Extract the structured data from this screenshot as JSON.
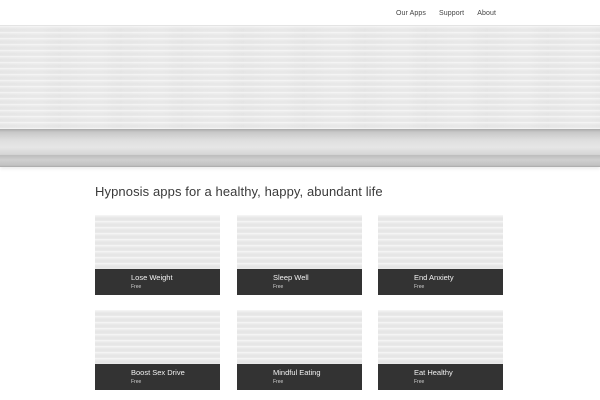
{
  "nav": {
    "items": [
      {
        "label": "Our Apps"
      },
      {
        "label": "Support"
      },
      {
        "label": "About"
      }
    ]
  },
  "headline": "Hypnosis apps for a healthy, happy, abundant life",
  "apps": [
    {
      "title": "Lose Weight",
      "price": "Free"
    },
    {
      "title": "Sleep Well",
      "price": "Free"
    },
    {
      "title": "End Anxiety",
      "price": "Free"
    },
    {
      "title": "Boost Sex Drive",
      "price": "Free"
    },
    {
      "title": "Mindful Eating",
      "price": "Free"
    },
    {
      "title": "Eat Healthy",
      "price": "Free"
    }
  ]
}
